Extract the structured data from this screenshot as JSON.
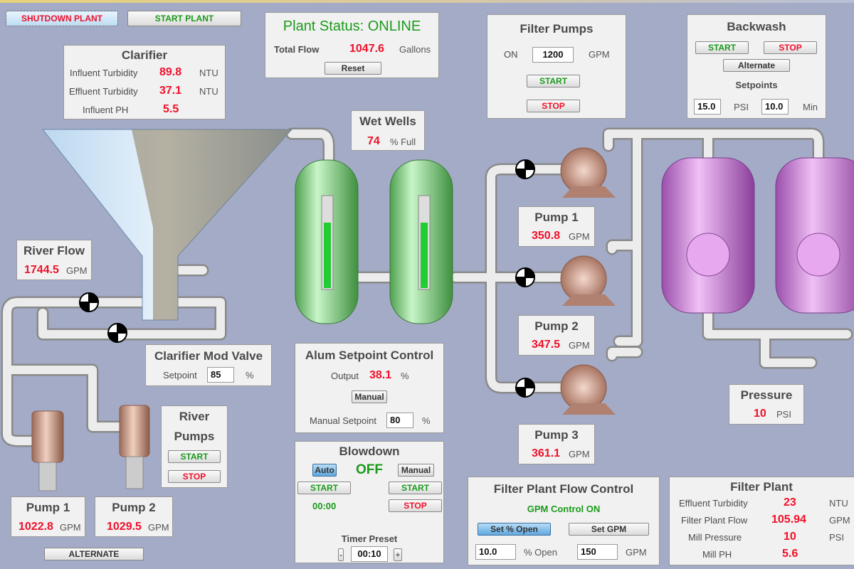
{
  "colors": {
    "background": "#a3abc7",
    "value": "#f0102a",
    "ok": "#1b9a1b",
    "well": "#8fdc8f",
    "filter": "#c27ad0",
    "pump": "#c89a86"
  },
  "top": {
    "shutdown": "SHUTDOWN PLANT",
    "start": "START PLANT"
  },
  "status": {
    "title": "Plant Status: ONLINE",
    "flow_label": "Total Flow",
    "flow": "1047.6",
    "flow_unit": "Gallons",
    "reset": "Reset"
  },
  "clarifier": {
    "title": "Clarifier",
    "rows": [
      {
        "label": "Influent Turbidity",
        "value": "89.8",
        "unit": "NTU"
      },
      {
        "label": "Effluent Turbidity",
        "value": "37.1",
        "unit": "NTU"
      },
      {
        "label": "Influent PH",
        "value": "5.5",
        "unit": ""
      }
    ]
  },
  "filter_pumps": {
    "title": "Filter Pumps",
    "on": "ON",
    "value": "1200",
    "unit": "GPM",
    "start": "START",
    "stop": "STOP"
  },
  "backwash": {
    "title": "Backwash",
    "start": "START",
    "stop": "STOP",
    "alternate": "Alternate",
    "setpoints": "Setpoints",
    "psi": "15.0",
    "psi_unit": "PSI",
    "min": "10.0",
    "min_unit": "Min"
  },
  "wet_wells": {
    "title": "Wet Wells",
    "value": "74",
    "unit": "% Full",
    "level_percent": 74
  },
  "river_flow": {
    "title": "River Flow",
    "value": "1744.5",
    "unit": "GPM"
  },
  "right_pumps": [
    {
      "title": "Pump 1",
      "value": "350.8",
      "unit": "GPM"
    },
    {
      "title": "Pump 2",
      "value": "347.5",
      "unit": "GPM"
    },
    {
      "title": "Pump 3",
      "value": "361.1",
      "unit": "GPM"
    }
  ],
  "mod_valve": {
    "title": "Clarifier Mod Valve",
    "label": "Setpoint",
    "value": "85",
    "unit": "%"
  },
  "alum": {
    "title": "Alum Setpoint Control",
    "output_label": "Output",
    "output": "38.1",
    "output_unit": "%",
    "manual": "Manual",
    "setpoint_label": "Manual Setpoint",
    "setpoint": "80",
    "setpoint_unit": "%"
  },
  "blowdown": {
    "title": "Blowdown",
    "auto": "Auto",
    "state": "OFF",
    "manual": "Manual",
    "start_left": "START",
    "start_right": "START",
    "stop": "STOP",
    "timer": "00:00",
    "preset_label": "Timer Preset",
    "minus": "-",
    "preset": "00:10",
    "plus": "+"
  },
  "river_pumps": {
    "title1": "River",
    "title2": "Pumps",
    "start": "START",
    "stop": "STOP"
  },
  "left_pumps": [
    {
      "title": "Pump 1",
      "value": "1022.8",
      "unit": "GPM"
    },
    {
      "title": "Pump 2",
      "value": "1029.5",
      "unit": "GPM"
    }
  ],
  "alternate": "ALTERNATE",
  "fpfc": {
    "title": "Filter Plant Flow Control",
    "status": "GPM Control ON",
    "set_open": "Set % Open",
    "set_gpm": "Set GPM",
    "open": "10.0",
    "open_unit": "% Open",
    "gpm": "150",
    "gpm_unit": "GPM"
  },
  "filter_plant": {
    "title": "Filter Plant",
    "rows": [
      {
        "label": "Effluent Turbidity",
        "value": "23",
        "unit": "NTU"
      },
      {
        "label": "Filter Plant Flow",
        "value": "105.94",
        "unit": "GPM"
      },
      {
        "label": "Mill Pressure",
        "value": "10",
        "unit": "PSI"
      },
      {
        "label": "Mill PH",
        "value": "5.6",
        "unit": ""
      }
    ]
  },
  "pressure": {
    "title": "Pressure",
    "value": "10",
    "unit": "PSI"
  }
}
